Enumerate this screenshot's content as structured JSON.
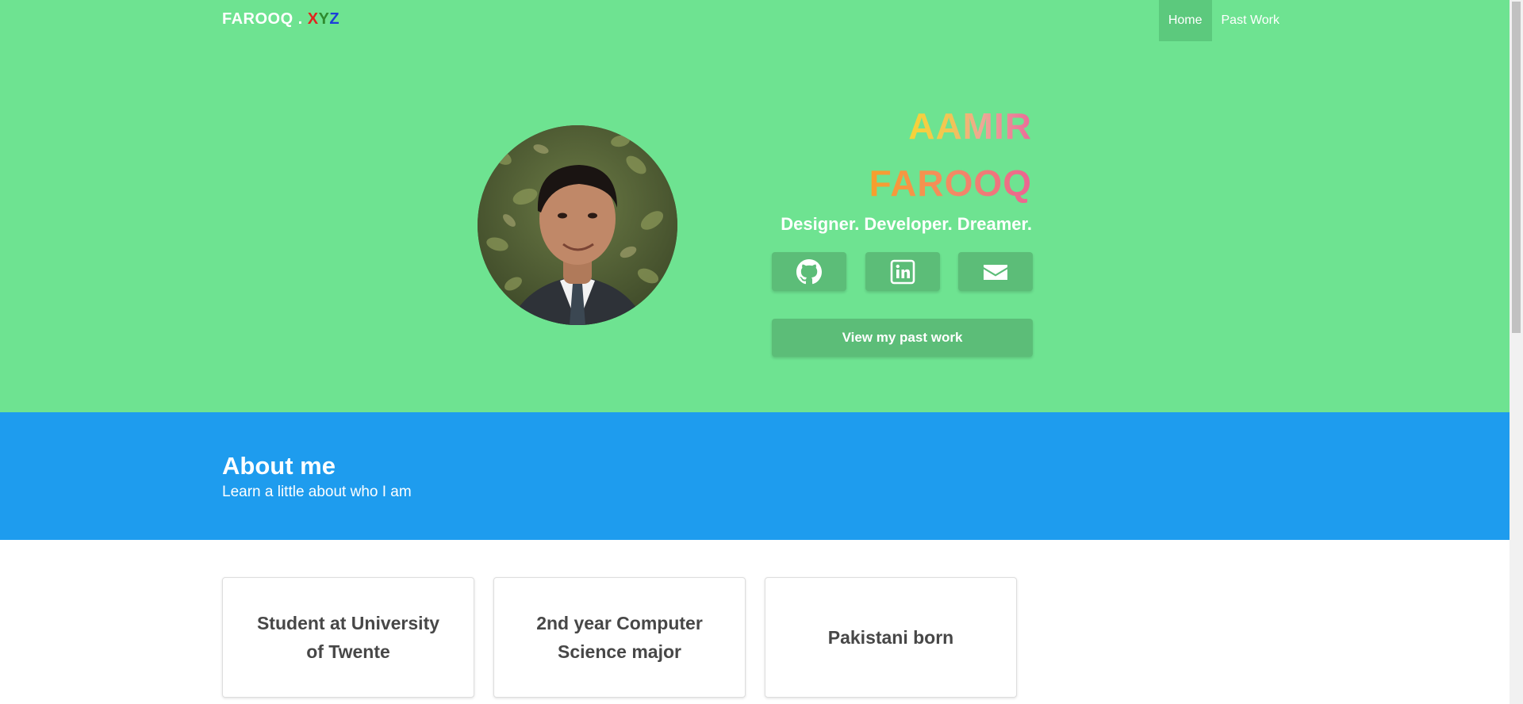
{
  "brand": {
    "name": "FAROOQ",
    "dot": ".",
    "x": "X",
    "y": "Y",
    "z": "Z"
  },
  "nav": {
    "home": "Home",
    "past_work": "Past Work"
  },
  "hero": {
    "first_name": "AAMIR",
    "last_name": "FAROOQ",
    "tagline": "Designer. Developer. Dreamer.",
    "cta_label": "View my past work",
    "social_icons": [
      "github-icon",
      "linkedin-icon",
      "envelope-icon"
    ]
  },
  "about": {
    "title": "About me",
    "subtitle": "Learn a little about who I am"
  },
  "cards": [
    {
      "text": "Student at University of Twente"
    },
    {
      "text": "2nd year Computer Science major"
    },
    {
      "text": "Pakistani born"
    }
  ],
  "colors": {
    "hero_bg": "#6ee391",
    "about_bg": "#1e9cee",
    "button_bg": "#5cbd78"
  }
}
